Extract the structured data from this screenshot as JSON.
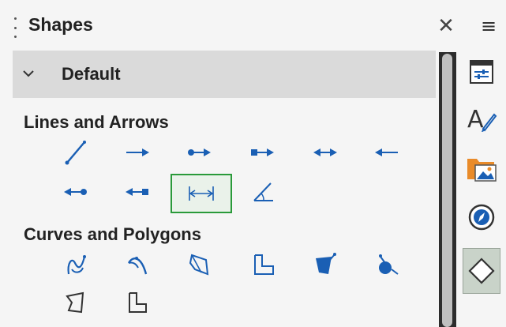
{
  "panel": {
    "title": "Shapes",
    "close_glyph": "✕",
    "menu_glyph": "≡"
  },
  "section": {
    "label": "Default",
    "expanded": true
  },
  "groups": [
    {
      "label": "Lines and Arrows",
      "shapes": [
        {
          "name": "line",
          "icon": "diagonal-line-icon"
        },
        {
          "name": "line-ends-with-arrow",
          "icon": "arrow-right-icon"
        },
        {
          "name": "line-circle-arrow",
          "icon": "circle-arrow-icon"
        },
        {
          "name": "line-square-arrow",
          "icon": "square-arrow-icon"
        },
        {
          "name": "line-with-arrows",
          "icon": "double-arrow-icon"
        },
        {
          "name": "line-starts-with-arrow",
          "icon": "arrow-left-icon"
        },
        {
          "name": "line-arrow-circle",
          "icon": "arrow-circle-icon"
        },
        {
          "name": "line-arrow-square",
          "icon": "arrow-square-icon"
        },
        {
          "name": "dimension-line",
          "icon": "dimension-line-icon",
          "selected": true
        },
        {
          "name": "angle-line",
          "icon": "angle-icon"
        }
      ]
    },
    {
      "label": "Curves and Polygons",
      "shapes": [
        {
          "name": "curve",
          "icon": "curve-icon"
        },
        {
          "name": "filled-curve",
          "icon": "filled-curve-icon"
        },
        {
          "name": "polygon",
          "icon": "polygon-icon"
        },
        {
          "name": "polygon-45",
          "icon": "polygon-45-icon"
        },
        {
          "name": "filled-polygon",
          "icon": "filled-polygon-icon"
        },
        {
          "name": "freeform-line",
          "icon": "freeform-icon"
        },
        {
          "name": "filled-polygon-2",
          "icon": "filled-polygon-icon"
        },
        {
          "name": "filled-polygon-45",
          "icon": "filled-polygon-45-icon"
        }
      ]
    }
  ],
  "sidebar": {
    "items": [
      {
        "name": "properties",
        "icon": "properties-icon"
      },
      {
        "name": "styles",
        "icon": "styles-icon"
      },
      {
        "name": "gallery",
        "icon": "gallery-icon"
      },
      {
        "name": "navigator",
        "icon": "navigator-icon"
      },
      {
        "name": "shapes",
        "icon": "shapes-icon",
        "active": true
      }
    ]
  },
  "colors": {
    "accent_blue": "#1a5fb4",
    "selected_border": "#2a9a3a",
    "section_bg": "#dadada"
  }
}
